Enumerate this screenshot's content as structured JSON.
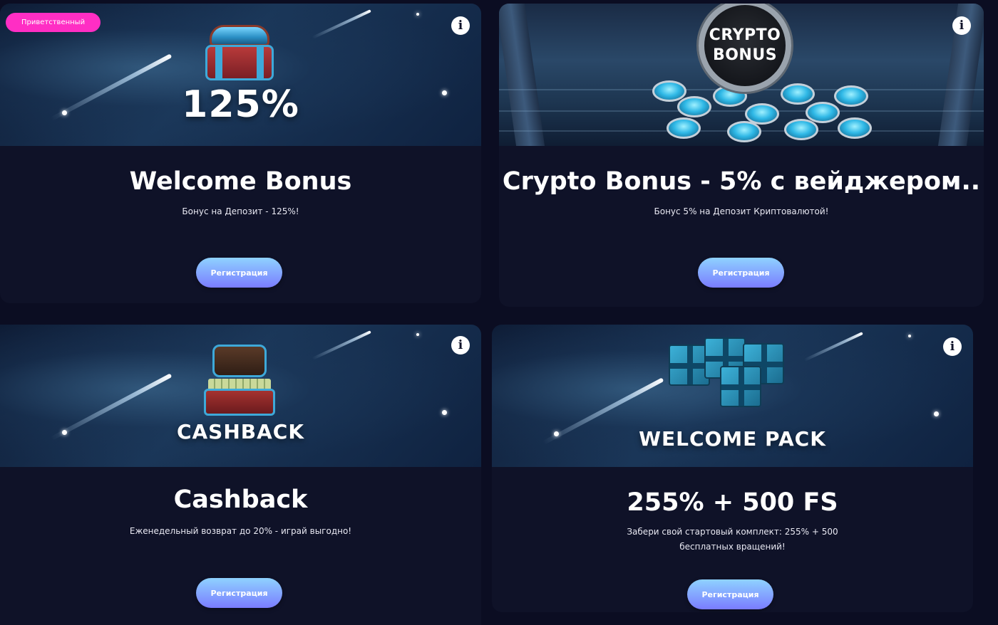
{
  "cards": [
    {
      "badge": "Приветственный",
      "banner_text": "125%",
      "title": "Welcome Bonus",
      "description": "Бонус на Депозит - 125%!",
      "button": "Регистрация",
      "info_icon": "info-icon"
    },
    {
      "banner_text_line1": "CRYPTO",
      "banner_text_line2": "BONUS",
      "title": "Crypto Bonus - 5% с вейджером..",
      "description": "Бонус 5% на Депозит Криптовалютой!",
      "button": "Регистрация",
      "info_icon": "info-icon"
    },
    {
      "banner_text": "CASHBACK",
      "title": "Cashback",
      "description": "Еженедельный возврат до 20% - играй выгодно!",
      "button": "Регистрация",
      "info_icon": "info-icon"
    },
    {
      "banner_text": "WELCOME PACK",
      "title": "255% + 500 FS",
      "description_line1": "Забери свой стартовый комплект: 255% + 500",
      "description_line2": "бесплатных вращений!",
      "button": "Регистрация",
      "info_icon": "info-icon"
    }
  ],
  "colors": {
    "background": "#0b0d22",
    "card": "#0f1228",
    "badge": "#ff2ec4",
    "button_top": "#8fd2ff",
    "button_bottom": "#7a7cff"
  }
}
